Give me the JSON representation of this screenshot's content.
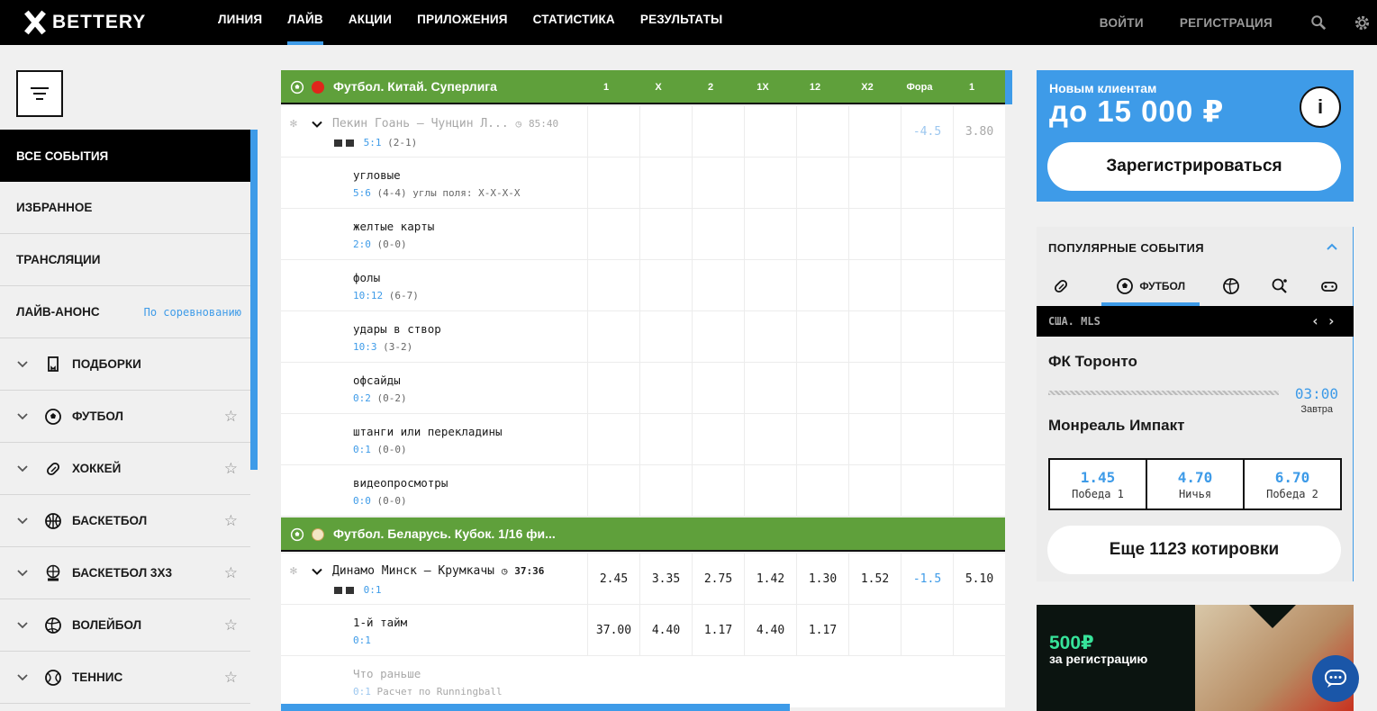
{
  "brand": {
    "name": "BETTERY"
  },
  "nav": [
    {
      "label": "ЛИНИЯ"
    },
    {
      "label": "ЛАЙВ",
      "active": true
    },
    {
      "label": "АКЦИИ"
    },
    {
      "label": "ПРИЛОЖЕНИЯ"
    },
    {
      "label": "СТАТИСТИКА"
    },
    {
      "label": "РЕЗУЛЬТАТЫ"
    }
  ],
  "header": {
    "login": "ВОЙТИ",
    "register": "РЕГИСТРАЦИЯ",
    "icons": [
      "search-icon",
      "settings-icon"
    ]
  },
  "sidebar": {
    "items": [
      {
        "label": "ВСЕ СОБЫТИЯ",
        "active": true
      },
      {
        "label": "ИЗБРАННОЕ"
      },
      {
        "label": "ТРАНСЛЯЦИИ"
      },
      {
        "label": "ЛАЙВ-АНОНС",
        "sub": "По соревнованию"
      }
    ],
    "sports": [
      {
        "label": "ПОДБОРКИ",
        "icon": "collection-icon",
        "star": false
      },
      {
        "label": "ФУТБОЛ",
        "icon": "football-icon",
        "star": true
      },
      {
        "label": "ХОККЕЙ",
        "icon": "hockey-icon",
        "star": true
      },
      {
        "label": "БАСКЕТБОЛ",
        "icon": "basketball-icon",
        "star": true
      },
      {
        "label": "БАСКЕТБОЛ 3Х3",
        "icon": "basketball-3x3-icon",
        "star": true
      },
      {
        "label": "ВОЛЕЙБОЛ",
        "icon": "volleyball-icon",
        "star": true
      },
      {
        "label": "ТЕННИС",
        "icon": "tennis-icon",
        "star": true
      }
    ]
  },
  "groups": [
    {
      "title": "Футбол. Китай. Суперлига",
      "columns": [
        "1",
        "X",
        "2",
        "1X",
        "12",
        "X2",
        "Фора",
        "1"
      ],
      "match": {
        "name": "Пекин Гоань — Чунцин Л...",
        "time": "85:40",
        "score": "5:1",
        "score_detail": "(2-1)",
        "cells": [
          "",
          "",
          "",
          "",
          "",
          "",
          "-4.5",
          "3.80"
        ]
      },
      "stats": [
        {
          "name": "угловые",
          "score": "5:6",
          "detail": "(4-4) углы поля: Х-Х-Х-Х"
        },
        {
          "name": "желтые карты",
          "score": "2:0",
          "detail": "(0-0)"
        },
        {
          "name": "фолы",
          "score": "10:12",
          "detail": "(6-7)"
        },
        {
          "name": "удары в створ",
          "score": "10:3",
          "detail": "(3-2)"
        },
        {
          "name": "офсайды",
          "score": "0:2",
          "detail": "(0-2)"
        },
        {
          "name": "штанги или перекладины",
          "score": "0:1",
          "detail": "(0-0)"
        },
        {
          "name": "видеопросмотры",
          "score": "0:0",
          "detail": "(0-0)"
        }
      ]
    },
    {
      "title": "Футбол. Беларусь. Кубок. 1/16 фи...",
      "match": {
        "name": "Динамо Минск — Крумкачы",
        "time": "37:36",
        "score": "0:1",
        "cells": [
          "2.45",
          "3.35",
          "2.75",
          "1.42",
          "1.30",
          "1.52",
          "-1.5",
          "5.10"
        ]
      },
      "half": {
        "name": "1-й тайм",
        "score": "0:1",
        "cells": [
          "37.00",
          "4.40",
          "1.17",
          "4.40",
          "1.17",
          "",
          "",
          ""
        ]
      },
      "extra": {
        "name": "Что раньше",
        "score": "0:1",
        "detail": "Расчет по Runningball"
      }
    }
  ],
  "promo": {
    "small": "Новым клиентам",
    "big": "до 15 000 ₽",
    "info": "i",
    "button": "Зарегистрироваться"
  },
  "popular": {
    "title": "ПОПУЛЯРНЫЕ СОБЫТИЯ",
    "active_tab": "ФУТБОЛ",
    "league": "США. MLS",
    "team1": "ФК Торонто",
    "team2": "Монреаль Импакт",
    "time": "03:00",
    "day": "Завтра",
    "odds": [
      {
        "value": "1.45",
        "label": "Победа 1"
      },
      {
        "value": "4.70",
        "label": "Ничья"
      },
      {
        "value": "6.70",
        "label": "Победа 2"
      }
    ],
    "more": "Еще 1123 котировки"
  },
  "banner": {
    "amount": "500₽",
    "text": "за регистрацию"
  },
  "colors": {
    "accent": "#3e9be8",
    "group": "#5fa03b",
    "black": "#000000"
  }
}
